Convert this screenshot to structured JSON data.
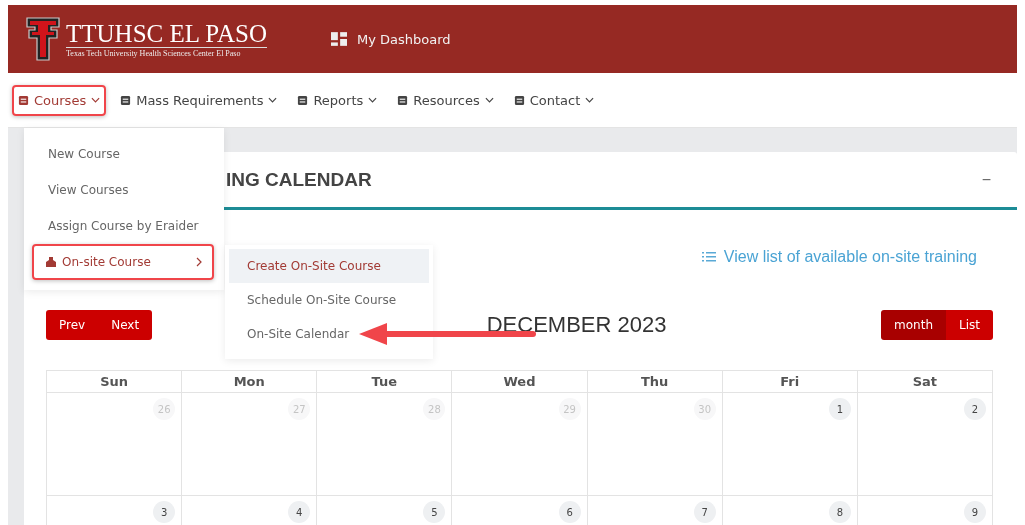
{
  "header": {
    "logo_title": "TTUHSC EL PASO",
    "logo_subtitle": "Texas Tech University Health Sciences Center El Paso",
    "dashboard_link": "My Dashboard"
  },
  "nav": [
    {
      "label": "Courses",
      "selected": true,
      "highlighted": true
    },
    {
      "label": "Mass Requirements",
      "selected": false,
      "highlighted": false
    },
    {
      "label": "Reports",
      "selected": false,
      "highlighted": false
    },
    {
      "label": "Resources",
      "selected": false,
      "highlighted": false
    },
    {
      "label": "Contact",
      "selected": false,
      "highlighted": false
    }
  ],
  "courses_menu": [
    {
      "label": "New Course",
      "submenu": false,
      "highlighted": false
    },
    {
      "label": "View Courses",
      "submenu": false,
      "highlighted": false
    },
    {
      "label": "Assign Course by Eraider",
      "submenu": false,
      "highlighted": false
    },
    {
      "label": "On-site Course",
      "submenu": true,
      "highlighted": true
    }
  ],
  "submenu": [
    {
      "label": "Create On-Site Course",
      "selected": true,
      "arrow": false
    },
    {
      "label": "Schedule On-Site Course",
      "selected": false,
      "arrow": false
    },
    {
      "label": "On-Site Calendar",
      "selected": false,
      "arrow": true
    }
  ],
  "card": {
    "title": "ING CALENDAR",
    "collapse": "−",
    "list_link": "View list of available on-site training"
  },
  "calendar": {
    "prev": "Prev",
    "next": "Next",
    "title": "DECEMBER 2023",
    "views": [
      {
        "label": "month",
        "selected": true
      },
      {
        "label": "List",
        "selected": false
      }
    ],
    "weekdays": [
      "Sun",
      "Mon",
      "Tue",
      "Wed",
      "Thu",
      "Fri",
      "Sat"
    ],
    "weeks": [
      [
        {
          "day": "26",
          "muted": true
        },
        {
          "day": "27",
          "muted": true
        },
        {
          "day": "28",
          "muted": true
        },
        {
          "day": "29",
          "muted": true
        },
        {
          "day": "30",
          "muted": true
        },
        {
          "day": "1",
          "muted": false
        },
        {
          "day": "2",
          "muted": false
        }
      ],
      [
        {
          "day": "3",
          "muted": false
        },
        {
          "day": "4",
          "muted": false
        },
        {
          "day": "5",
          "muted": false
        },
        {
          "day": "6",
          "muted": false
        },
        {
          "day": "7",
          "muted": false
        },
        {
          "day": "8",
          "muted": false
        },
        {
          "day": "9",
          "muted": false
        }
      ]
    ]
  }
}
